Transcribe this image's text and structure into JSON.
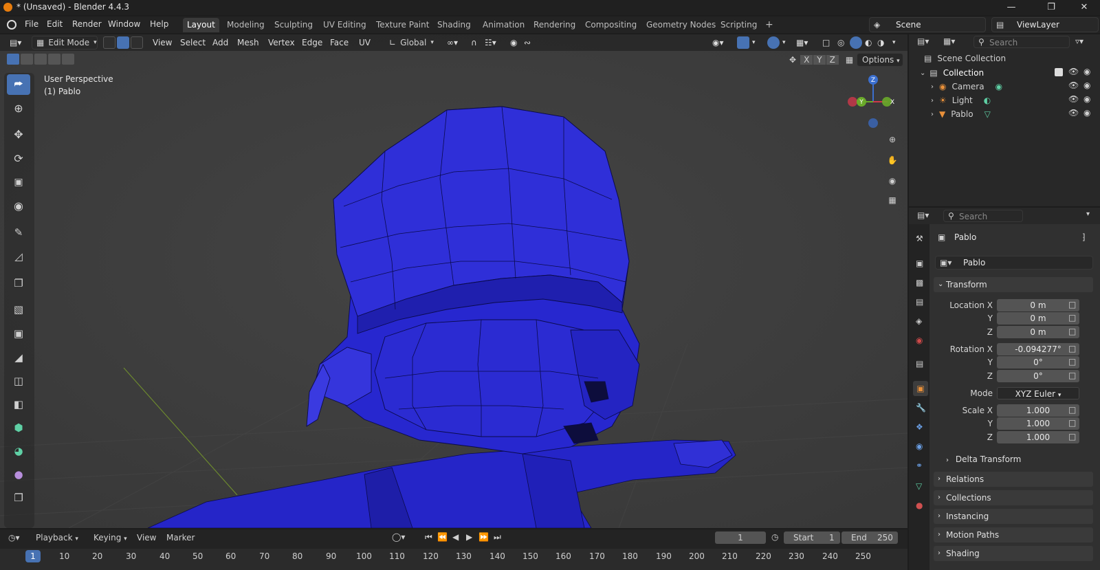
{
  "title_bar": {
    "title": "* (Unsaved) - Blender 4.4.3"
  },
  "menus": [
    "File",
    "Edit",
    "Render",
    "Window",
    "Help"
  ],
  "workspaces": [
    "Layout",
    "Modeling",
    "Sculpting",
    "UV Editing",
    "Texture Paint",
    "Shading",
    "Animation",
    "Rendering",
    "Compositing",
    "Geometry Nodes",
    "Scripting"
  ],
  "active_workspace": "Layout",
  "scene": {
    "label": "Scene",
    "viewlayer": "ViewLayer"
  },
  "viewport_header": {
    "mode": "Edit Mode",
    "menus": [
      "View",
      "Select",
      "Add",
      "Mesh",
      "Vertex",
      "Edge",
      "Face",
      "UV"
    ],
    "orientation": "Global",
    "options": "Options",
    "axes": [
      "X",
      "Y",
      "Z"
    ]
  },
  "viewport_overlay": {
    "perspective": "User Perspective",
    "object": "(1) Pablo"
  },
  "gizmo": {
    "z": "Z",
    "y": "Y",
    "x": "X"
  },
  "outliner": {
    "search_placeholder": "Search",
    "scene_collection": "Scene Collection",
    "collection": "Collection",
    "items": [
      "Camera",
      "Light",
      "Pablo"
    ]
  },
  "properties": {
    "search_placeholder": "Search",
    "object_name": "Pablo",
    "object_field": "Pablo",
    "transform_title": "Transform",
    "location": {
      "label_x": "Location X",
      "label_y": "Y",
      "label_z": "Z",
      "x": "0 m",
      "y": "0 m",
      "z": "0 m"
    },
    "rotation": {
      "label_x": "Rotation X",
      "label_y": "Y",
      "label_z": "Z",
      "x": "-0.094277°",
      "y": "0°",
      "z": "0°"
    },
    "mode": {
      "label": "Mode",
      "value": "XYZ Euler"
    },
    "scale": {
      "label_x": "Scale X",
      "label_y": "Y",
      "label_z": "Z",
      "x": "1.000",
      "y": "1.000",
      "z": "1.000"
    },
    "delta_transform": "Delta Transform",
    "panels": [
      "Relations",
      "Collections",
      "Instancing",
      "Motion Paths",
      "Shading"
    ]
  },
  "timeline": {
    "menus": [
      "Playback",
      "Keying",
      "View",
      "Marker"
    ],
    "current_frame": "1",
    "start_label": "Start",
    "start": "1",
    "end_label": "End",
    "end": "250",
    "ruler": [
      "1",
      "10",
      "20",
      "30",
      "40",
      "50",
      "60",
      "70",
      "80",
      "90",
      "100",
      "110",
      "120",
      "130",
      "140",
      "150",
      "160",
      "170",
      "180",
      "190",
      "200",
      "210",
      "220",
      "230",
      "240",
      "250"
    ]
  },
  "colors": {
    "accent": "#4772b3",
    "mesh": "#2a2acc",
    "mesh_dark": "#1c1c9a"
  }
}
